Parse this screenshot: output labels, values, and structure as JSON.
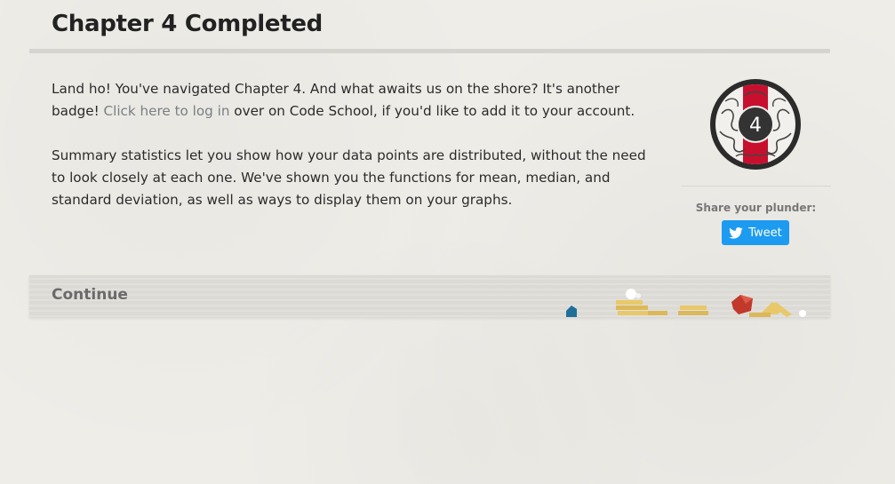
{
  "header": {
    "title": "Chapter 4 Completed"
  },
  "content": {
    "paragraph1_before_link": "Land ho! You've navigated Chapter 4. And what awaits us on the shore? It's another badge! ",
    "login_link": "Click here to log in",
    "paragraph1_after_link": " over on Code School, if you'd like to add it to your account.",
    "paragraph2": "Summary statistics let you show how your data points are distributed, without the need to look closely at each one. We've shown you the functions for mean, median, and standard deviation, as well as ways to display them on your graphs."
  },
  "badge": {
    "number": "4",
    "colors": {
      "ring": "#2b2b2b",
      "stripe": "#c8102e",
      "center": "#333333"
    }
  },
  "share": {
    "label": "Share your plunder:",
    "tweet_label": "Tweet",
    "icon": "twitter-bird-icon",
    "color": "#1d9bf0"
  },
  "continue_bar": {
    "label": "Continue"
  }
}
